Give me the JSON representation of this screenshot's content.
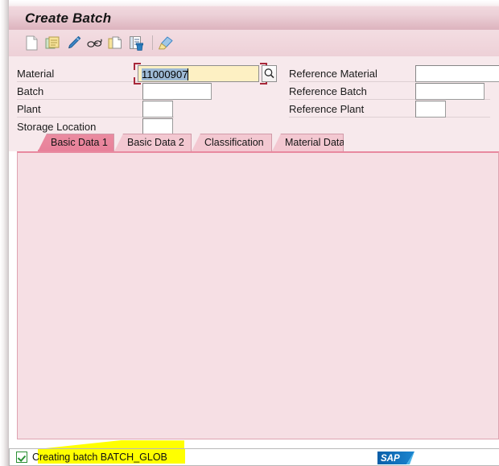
{
  "window": {
    "title": "Create Batch"
  },
  "toolbar": {
    "items": [
      {
        "name": "new-document-icon",
        "tooltip": "Create"
      },
      {
        "name": "copy-reference-icon",
        "tooltip": "Create with Reference"
      },
      {
        "name": "edit-pencil-icon",
        "tooltip": "Change"
      },
      {
        "name": "display-glasses-icon",
        "tooltip": "Display"
      },
      {
        "name": "new-page-icon",
        "tooltip": "Create New"
      },
      {
        "name": "delete-list-icon",
        "tooltip": "Delete"
      },
      {
        "name": "eraser-icon",
        "tooltip": "Clear"
      }
    ]
  },
  "form": {
    "left": [
      {
        "label": "Material",
        "value": "11000907",
        "placeholder": ""
      },
      {
        "label": "Batch",
        "value": "",
        "placeholder": ""
      },
      {
        "label": "Plant",
        "value": "",
        "placeholder": ""
      },
      {
        "label": "Storage Location",
        "value": "",
        "placeholder": ""
      }
    ],
    "right": [
      {
        "label": "Reference Material",
        "value": "",
        "placeholder": ""
      },
      {
        "label": "Reference Batch",
        "value": "",
        "placeholder": ""
      },
      {
        "label": "Reference Plant",
        "value": "",
        "placeholder": ""
      }
    ]
  },
  "tabs": [
    {
      "label": "Basic Data 1",
      "active": true
    },
    {
      "label": "Basic Data 2",
      "active": false
    },
    {
      "label": "Classification",
      "active": false
    },
    {
      "label": "Material Data",
      "active": false
    }
  ],
  "status": {
    "icon": "success-check-icon",
    "message": "Creating batch BATCH_GLOB",
    "logo": "sap-logo"
  },
  "colors": {
    "title_bar": "#e2bdc6",
    "toolbar": "#f0d6dc",
    "form_bg": "#f7e9ec",
    "panel_bg": "#f6dfe4",
    "tab_active": "#e8899f",
    "tab_inactive": "#f3c8d1",
    "focus_field": "#fdf0c3",
    "selection": "#9db9d4",
    "focus_bracket": "#a8283a",
    "highlight": "#ffff00",
    "sap_blue": "#0a6ebd",
    "status_ok": "#2a9235"
  }
}
